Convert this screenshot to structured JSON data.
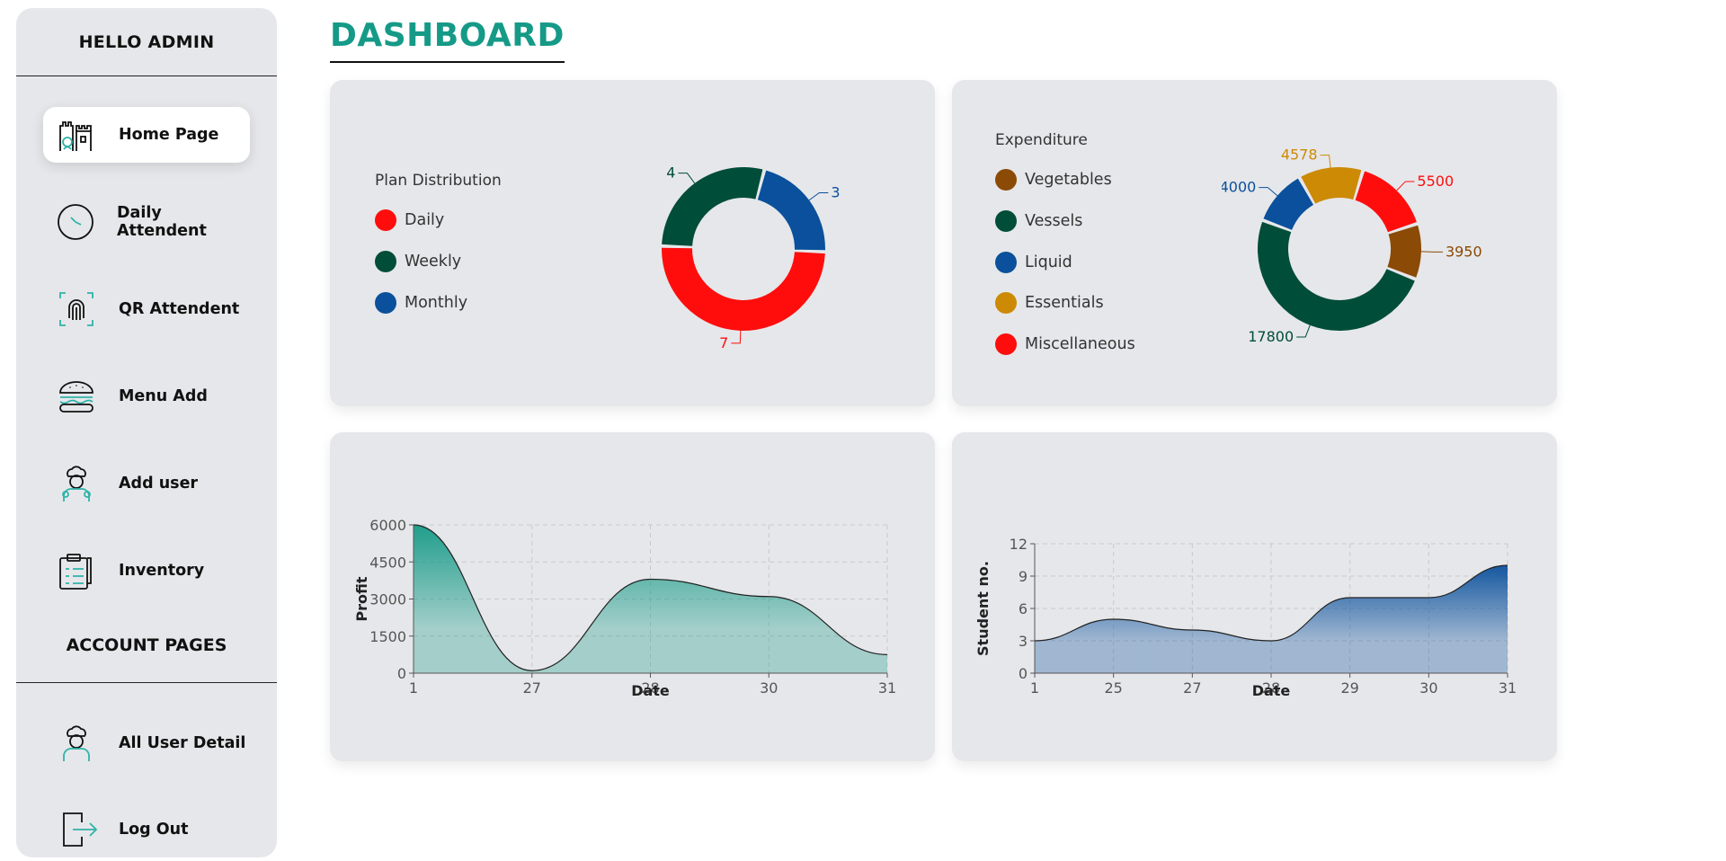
{
  "sidebar": {
    "greeting": "HELLO ADMIN",
    "items": [
      {
        "label": "Home Page",
        "icon": "home-castle-icon",
        "active": true
      },
      {
        "label": "Daily Attendent",
        "icon": "clock-icon"
      },
      {
        "label": "QR Attendent",
        "icon": "fingerprint-icon"
      },
      {
        "label": "Menu Add",
        "icon": "burger-icon"
      },
      {
        "label": "Add user",
        "icon": "chef-user-icon"
      }
    ],
    "inventory_label": "Inventory",
    "account_heading": "ACCOUNT PAGES",
    "account_items": [
      {
        "label": "All User Detail",
        "icon": "chef-user-icon"
      },
      {
        "label": "Log Out",
        "icon": "logout-icon"
      }
    ]
  },
  "header": {
    "title": "DASHBOARD"
  },
  "colors": {
    "accent": "#159a87",
    "red": "#ff0d0d",
    "green": "#004d3a",
    "blue": "#0a509c",
    "brown": "#8b4a05",
    "gold": "#cc8a05"
  },
  "chart_data": [
    {
      "type": "pie",
      "title": "Plan Distribution",
      "categories": [
        "Daily",
        "Weekly",
        "Monthly"
      ],
      "values": [
        7,
        4,
        3
      ],
      "colors": [
        "#ff0d0d",
        "#004d3a",
        "#0a509c"
      ],
      "donut": true,
      "legend": "left"
    },
    {
      "type": "pie",
      "title": "Expenditure",
      "categories": [
        "Vegetables",
        "Vessels",
        "Liquid",
        "Essentials",
        "Miscellaneous"
      ],
      "values": [
        3950,
        17800,
        4000,
        4578,
        5500
      ],
      "colors": [
        "#8b4a05",
        "#004d3a",
        "#0a509c",
        "#cc8a05",
        "#ff0d0d"
      ],
      "donut": true,
      "legend": "left"
    },
    {
      "type": "area",
      "xlabel": "Date",
      "ylabel": "Profit",
      "categories": [
        "1",
        "27",
        "28",
        "30",
        "31"
      ],
      "values": [
        6000,
        100,
        3800,
        3100,
        750
      ],
      "ylim": [
        0,
        6000
      ],
      "yticks": [
        0,
        1500,
        3000,
        4500,
        6000
      ],
      "grid": true,
      "color": "#159a87"
    },
    {
      "type": "area",
      "xlabel": "Date",
      "ylabel": "Student no.",
      "categories": [
        "1",
        "25",
        "27",
        "28",
        "29",
        "30",
        "31"
      ],
      "values": [
        3,
        5,
        4,
        3,
        7,
        7,
        10
      ],
      "ylim": [
        0,
        12
      ],
      "yticks": [
        0,
        3,
        6,
        9,
        12
      ],
      "grid": true,
      "color": "#0a509c"
    }
  ]
}
